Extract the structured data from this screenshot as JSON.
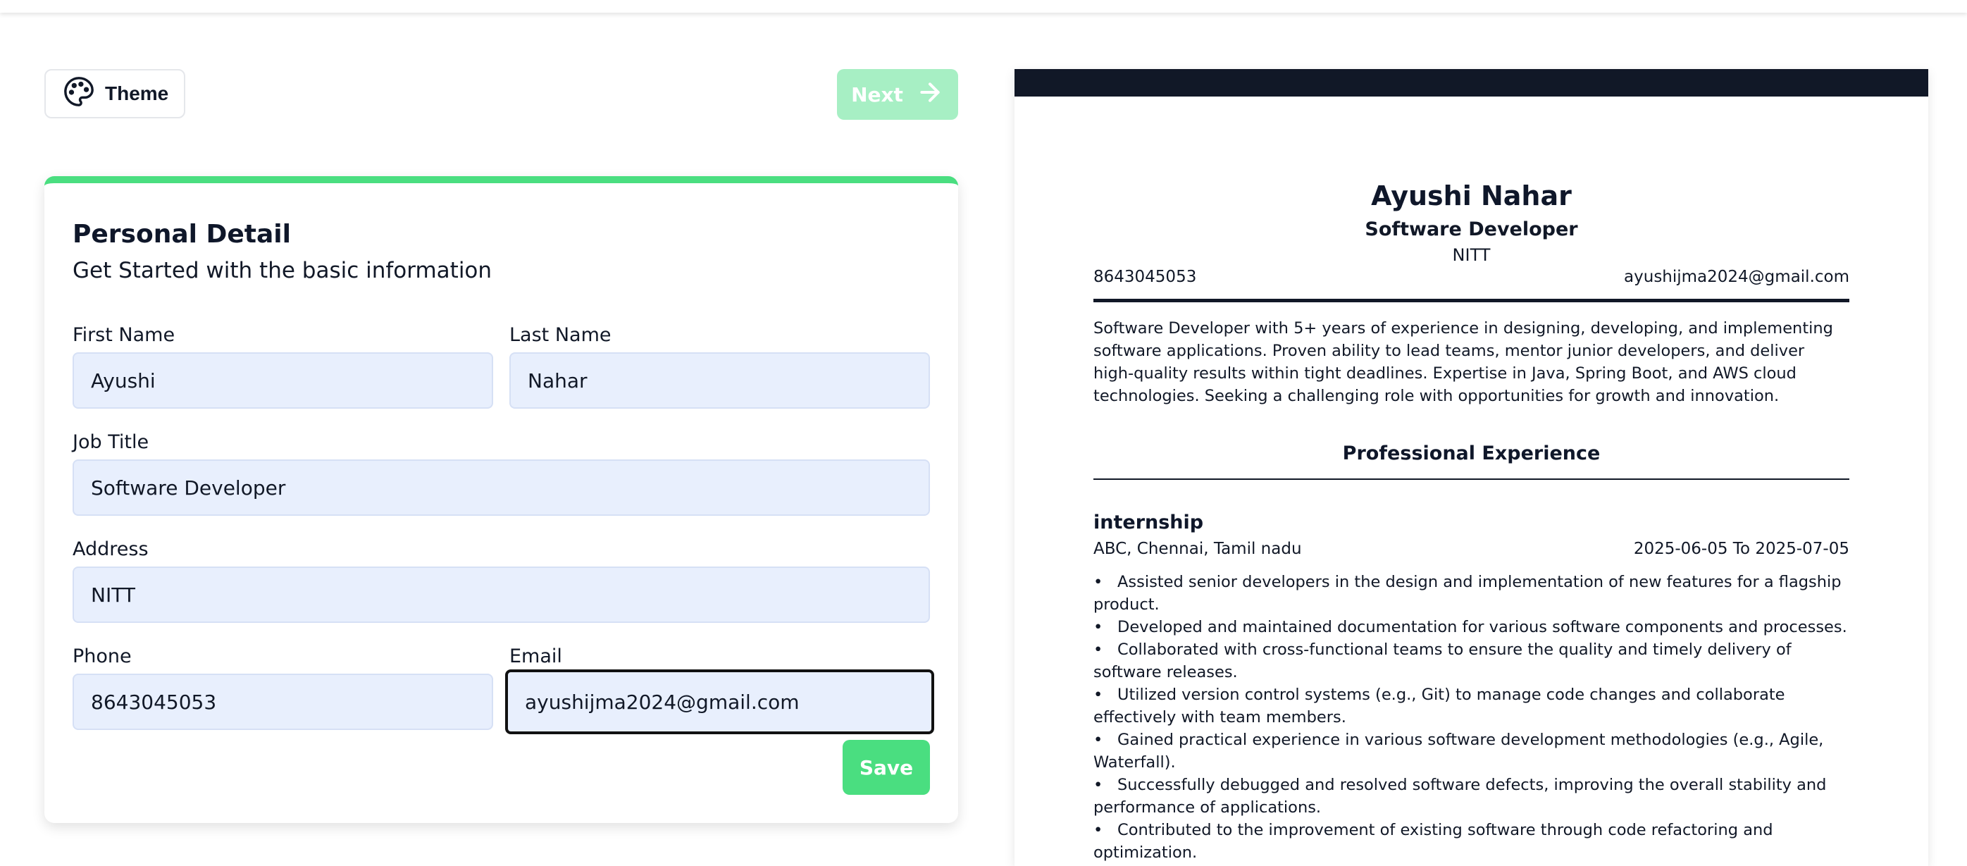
{
  "toolbar": {
    "theme_label": "Theme",
    "next_label": "Next"
  },
  "form": {
    "title": "Personal Detail",
    "subtitle": "Get Started with the basic information",
    "fields": {
      "first_name": {
        "label": "First Name",
        "value": "Ayushi"
      },
      "last_name": {
        "label": "Last Name",
        "value": "Nahar"
      },
      "job_title": {
        "label": "Job Title",
        "value": "Software Developer"
      },
      "address": {
        "label": "Address",
        "value": "NITT"
      },
      "phone": {
        "label": "Phone",
        "value": "8643045053"
      },
      "email": {
        "label": "Email",
        "value": "ayushijma2024@gmail.com"
      }
    },
    "save_label": "Save"
  },
  "resume": {
    "name": "Ayushi Nahar",
    "job_title": "Software Developer",
    "address": "NITT",
    "phone": "8643045053",
    "email": "ayushijma2024@gmail.com",
    "summary": "Software Developer with 5+ years of experience in designing, developing, and implementing software applications. Proven ability to lead teams, mentor junior developers, and deliver high-quality results within tight deadlines. Expertise in Java, Spring Boot, and AWS cloud technologies. Seeking a challenging role with opportunities for growth and innovation.",
    "experience_heading": "Professional Experience",
    "experience": [
      {
        "title": "internship",
        "company": "ABC, Chennai, Tamil nadu",
        "dates": "2025-06-05 To 2025-07-05",
        "bullets": [
          "Assisted senior developers in the design and implementation of new features for a flagship product.",
          "Developed and maintained documentation for various software components and processes.",
          "Collaborated with cross-functional teams to ensure the quality and timely delivery of software releases.",
          "Utilized version control systems (e.g., Git) to manage code changes and collaborate effectively with team members.",
          "Gained practical experience in various software development methodologies (e.g., Agile, Waterfall).",
          "Successfully debugged and resolved software defects, improving the overall stability and performance of applications.",
          "Contributed to the improvement of existing software through code refactoring and optimization."
        ]
      }
    ]
  },
  "colors": {
    "accent": "#4ade80",
    "accent_disabled": "#a7efc4",
    "input_bg": "#e8effd",
    "resume_header": "#111827"
  }
}
